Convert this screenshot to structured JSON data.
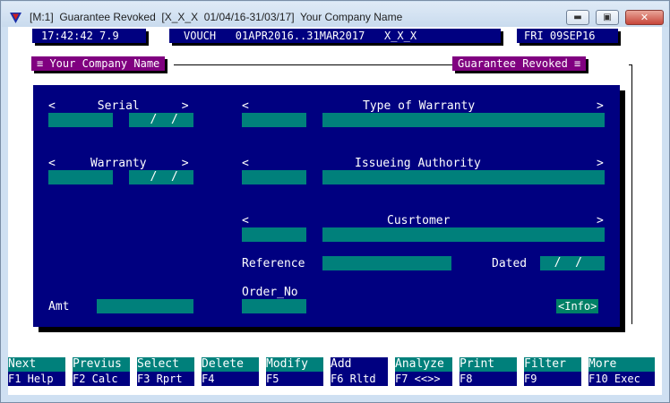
{
  "window": {
    "title": "[M:1]  Guarantee Revoked  [X_X_X  01/04/16-31/03/17]  Your Company Name"
  },
  "header": {
    "clock": "17:42:42 7.9",
    "voucher": "VOUCH   01APR2016..31MAR2017   X_X_X",
    "date": "FRI 09SEP16"
  },
  "frame": {
    "left_title": "≡ Your Company Name",
    "right_title": "Guarantee Revoked ≡"
  },
  "form": {
    "serial_label": "<      Serial      >",
    "serial_value": "",
    "serial_date": "   /  /",
    "warranty_label": "<     Warranty     >",
    "warranty_value": "",
    "warranty_date": "   /  /",
    "type_open": "<",
    "type_label": "Type of Warranty",
    "type_close": ">",
    "type_code": "",
    "type_value": "",
    "auth_open": "<",
    "auth_label": "Issueing Authority",
    "auth_close": ">",
    "auth_code": "",
    "auth_value": "",
    "cust_open": "<",
    "cust_label": "Cusrtomer",
    "cust_close": ">",
    "cust_code": "",
    "cust_value": "",
    "reference_label": "Reference",
    "reference_value": "",
    "dated_label": "Dated",
    "dated_value": "  /  /",
    "order_label": "Order_No",
    "order_value": "",
    "amt_label": "Amt",
    "amt_value": "",
    "info_button": "<Info>"
  },
  "fkeys": [
    {
      "top": "Next",
      "bottom": "F1 Help"
    },
    {
      "top": "Previus",
      "bottom": "F2 Calc"
    },
    {
      "top": "Select",
      "bottom": "F3 Rprt"
    },
    {
      "top": "Delete",
      "bottom": "F4"
    },
    {
      "top": "Modify",
      "bottom": "F5"
    },
    {
      "top": "Add",
      "bottom": "F6 Rltd"
    },
    {
      "top": "Analyze",
      "bottom": "F7 <<>>"
    },
    {
      "top": "Print",
      "bottom": "F8"
    },
    {
      "top": "Filter",
      "bottom": "F9"
    },
    {
      "top": "More",
      "bottom": "F10 Exec"
    }
  ],
  "colors": {
    "panel": "#000080",
    "field": "#00807b",
    "frame_bar": "#800080"
  }
}
